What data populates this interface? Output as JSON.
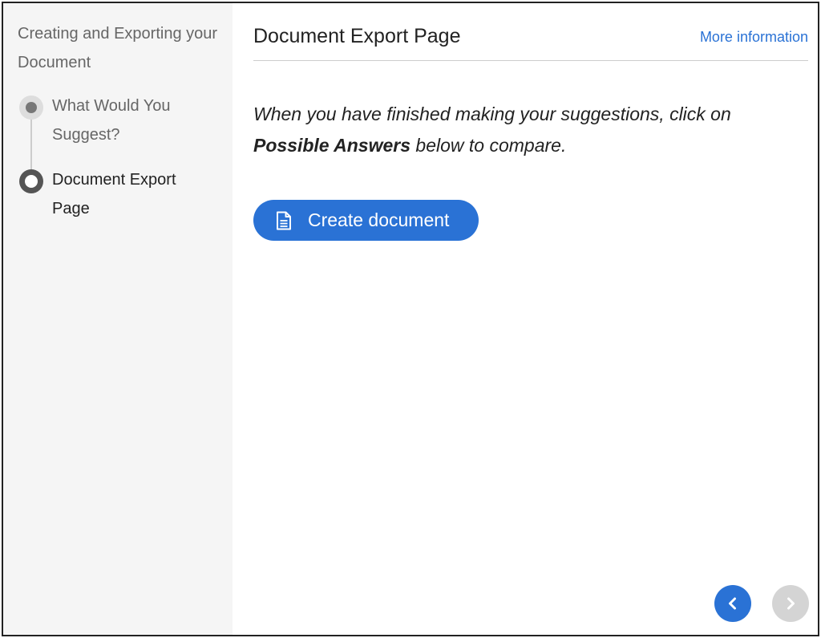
{
  "sidebar": {
    "title": "Creating and Exporting your Document",
    "steps": [
      {
        "label": "What Would You Suggest?",
        "state": "completed"
      },
      {
        "label": "Document Export Page",
        "state": "current"
      }
    ]
  },
  "header": {
    "title": "Document Export Page",
    "more_info_label": "More information"
  },
  "content": {
    "instruction_before": "When you have finished making your suggestions, click on ",
    "instruction_bold": "Possible Answers",
    "instruction_after": " below to compare."
  },
  "actions": {
    "create_label": "Create document",
    "create_icon": "document-icon"
  },
  "navigation": {
    "prev_icon": "chevron-left-icon",
    "next_icon": "chevron-right-icon",
    "next_enabled": false
  },
  "colors": {
    "accent": "#2a72d5",
    "sidebar_bg": "#f5f5f5",
    "disabled": "#d4d4d4"
  }
}
